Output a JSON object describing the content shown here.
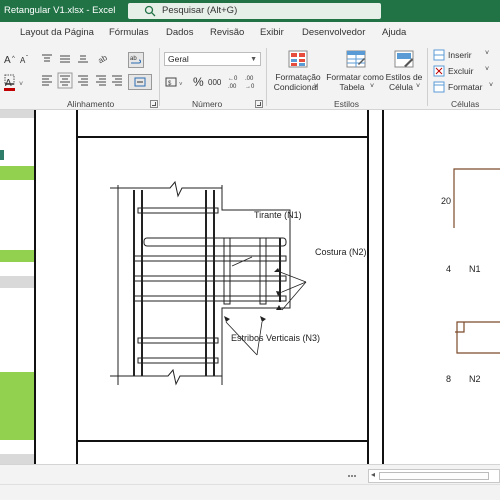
{
  "app": {
    "window_title": "Retangular V1.xlsx  -  Excel",
    "search_placeholder": "Pesquisar (Alt+G)",
    "accent_color": "#217346"
  },
  "ribbon": {
    "tabs": [
      "Layout da Página",
      "Fórmulas",
      "Dados",
      "Revisão",
      "Exibir",
      "Desenvolvedor",
      "Ajuda"
    ],
    "groups": {
      "alinhamento": "Alinhamento",
      "numero": "Número",
      "estilos": "Estilos",
      "celulas": "Células"
    },
    "number_format": {
      "value": "Geral"
    },
    "number_buttons": {
      "percent": "%",
      "thousands": "000"
    },
    "styles_buttons": {
      "conditional": [
        "Formatação",
        "Condicional"
      ],
      "as_table": [
        "Formatar como",
        "Tabela"
      ],
      "cell_styles": [
        "Estilos de",
        "Célula"
      ]
    },
    "cells_buttons": {
      "insert": "Inserir",
      "delete": "Excluir",
      "format": "Formatar"
    }
  },
  "sheet": {
    "drawing_labels": {
      "tirante": "Tirante (N1)",
      "costura": "Costura (N2)",
      "estribos": "Estribos Verticais (N3)"
    },
    "cells": {
      "value_20": "20",
      "value_4": "4",
      "value_n1": "N1",
      "value_8": "8",
      "value_n2": "N2"
    }
  },
  "icons": [
    "search-icon",
    "paste-icon",
    "bold-icon",
    "wrap-text-icon",
    "merge-icon",
    "percent-icon",
    "conditional-format-icon",
    "format-table-icon",
    "cell-styles-icon",
    "insert-icon",
    "delete-icon",
    "format-icon"
  ]
}
